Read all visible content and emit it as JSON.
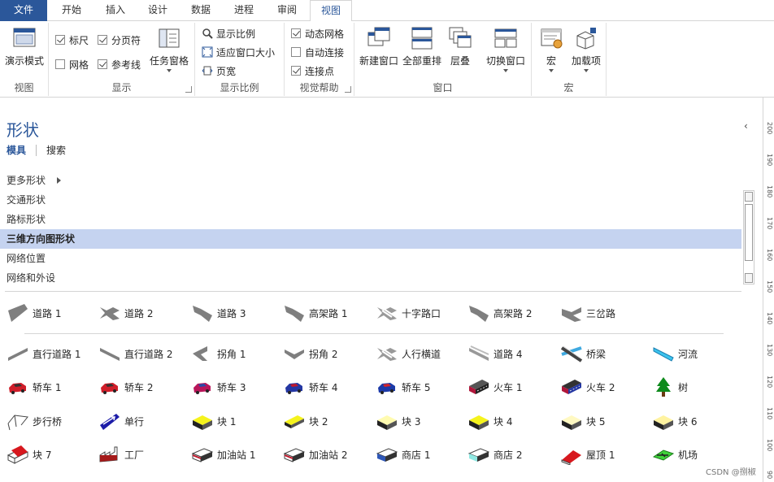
{
  "tabs": [
    {
      "label": "文件"
    },
    {
      "label": "开始"
    },
    {
      "label": "插入"
    },
    {
      "label": "设计"
    },
    {
      "label": "数据"
    },
    {
      "label": "进程"
    },
    {
      "label": "审阅"
    },
    {
      "label": "视图"
    }
  ],
  "ribbon": {
    "view_group": {
      "label": "视图",
      "present_mode": "演示模式"
    },
    "show_group": {
      "label": "显示",
      "ruler": "标尺",
      "page_breaks": "分页符",
      "grid": "网格",
      "guides": "参考线",
      "task_panes": "任务窗格"
    },
    "zoom_group": {
      "label": "显示比例",
      "zoom": "显示比例",
      "fit_window": "适应窗口大小",
      "page_width": "页宽"
    },
    "visual_aids_group": {
      "label": "视觉帮助",
      "dynamic_grid": "动态网格",
      "auto_connect": "自动连接",
      "connection_points": "连接点"
    },
    "window_group": {
      "label": "窗口",
      "new_window": "新建窗口",
      "arrange_all": "全部重排",
      "cascade": "层叠",
      "switch_windows": "切换窗口"
    },
    "macro_group": {
      "label": "宏",
      "macros": "宏",
      "add_ins": "加载项"
    }
  },
  "pane": {
    "title": "形状",
    "tab_stencils": "模具",
    "tab_search": "搜索",
    "more_shapes": "更多形状",
    "stencils": [
      "交通形状",
      "路标形状",
      "三维方向图形状",
      "网络位置",
      "网络和外设"
    ]
  },
  "shapes": [
    "道路 1",
    "道路 2",
    "道路 3",
    "高架路 1",
    "十字路口",
    "高架路 2",
    "三岔路",
    "直行道路 1",
    "直行道路 2",
    "拐角 1",
    "拐角 2",
    "人行横道",
    "道路 4",
    "桥梁",
    "河流",
    "轿车 1",
    "轿车 2",
    "轿车 3",
    "轿车 4",
    "轿车 5",
    "火车 1",
    "火车 2",
    "树",
    "步行桥",
    "单行",
    "块 1",
    "块 2",
    "块 3",
    "块 4",
    "块 5",
    "块 6",
    "块 7",
    "工厂",
    "加油站 1",
    "加油站 2",
    "商店 1",
    "商店 2",
    "屋顶 1",
    "机场"
  ],
  "ruler_ticks": [
    "200",
    "190",
    "180",
    "170",
    "160",
    "150",
    "140",
    "130",
    "120",
    "110",
    "100",
    "90"
  ],
  "watermark": "CSDN @捌椒",
  "colors": {
    "accent": "#2b579a",
    "selected": "#c5d3f0"
  }
}
